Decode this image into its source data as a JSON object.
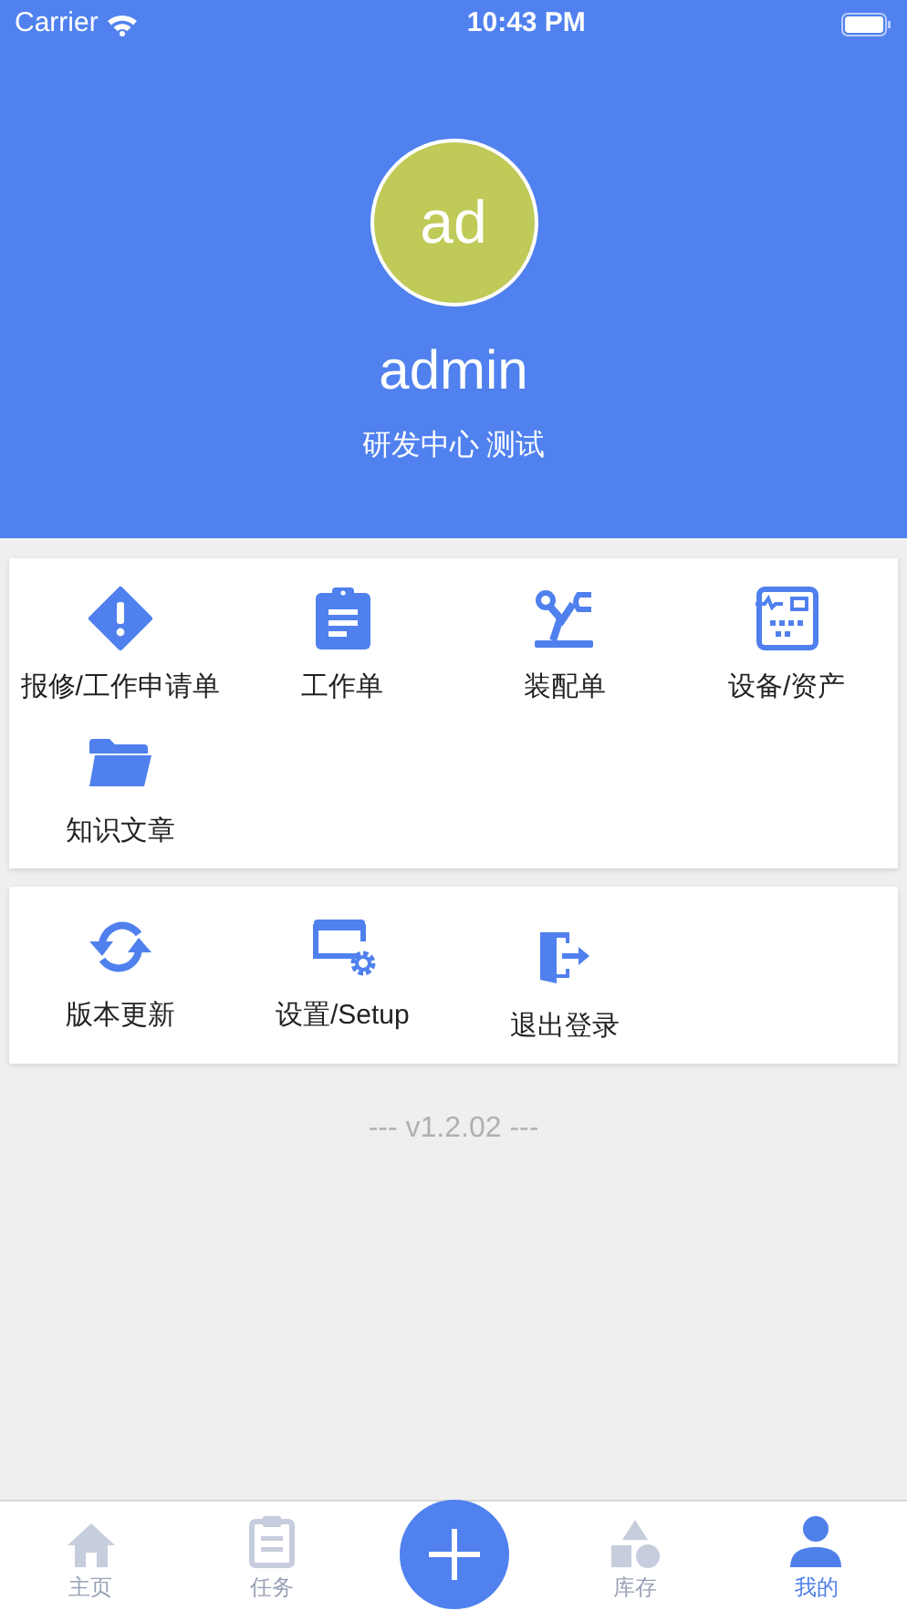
{
  "status_bar": {
    "carrier": "Carrier",
    "time": "10:43 PM"
  },
  "profile": {
    "avatar_initials": "ad",
    "username": "admin",
    "department": "研发中心 测试"
  },
  "menu_sections": [
    {
      "items": [
        {
          "label": "报修/工作申请单"
        },
        {
          "label": "工作单"
        },
        {
          "label": "装配单"
        },
        {
          "label": "设备/资产"
        },
        {
          "label": "知识文章"
        }
      ]
    },
    {
      "items": [
        {
          "label": "版本更新"
        },
        {
          "label": "设置/Setup"
        },
        {
          "label": "退出登录"
        }
      ]
    }
  ],
  "version": "--- v1.2.02 ---",
  "tab_bar": [
    {
      "label": "主页",
      "selected": false
    },
    {
      "label": "任务",
      "selected": false
    },
    {
      "kind": "add"
    },
    {
      "label": "库存",
      "selected": false
    },
    {
      "label": "我的",
      "selected": true
    }
  ]
}
